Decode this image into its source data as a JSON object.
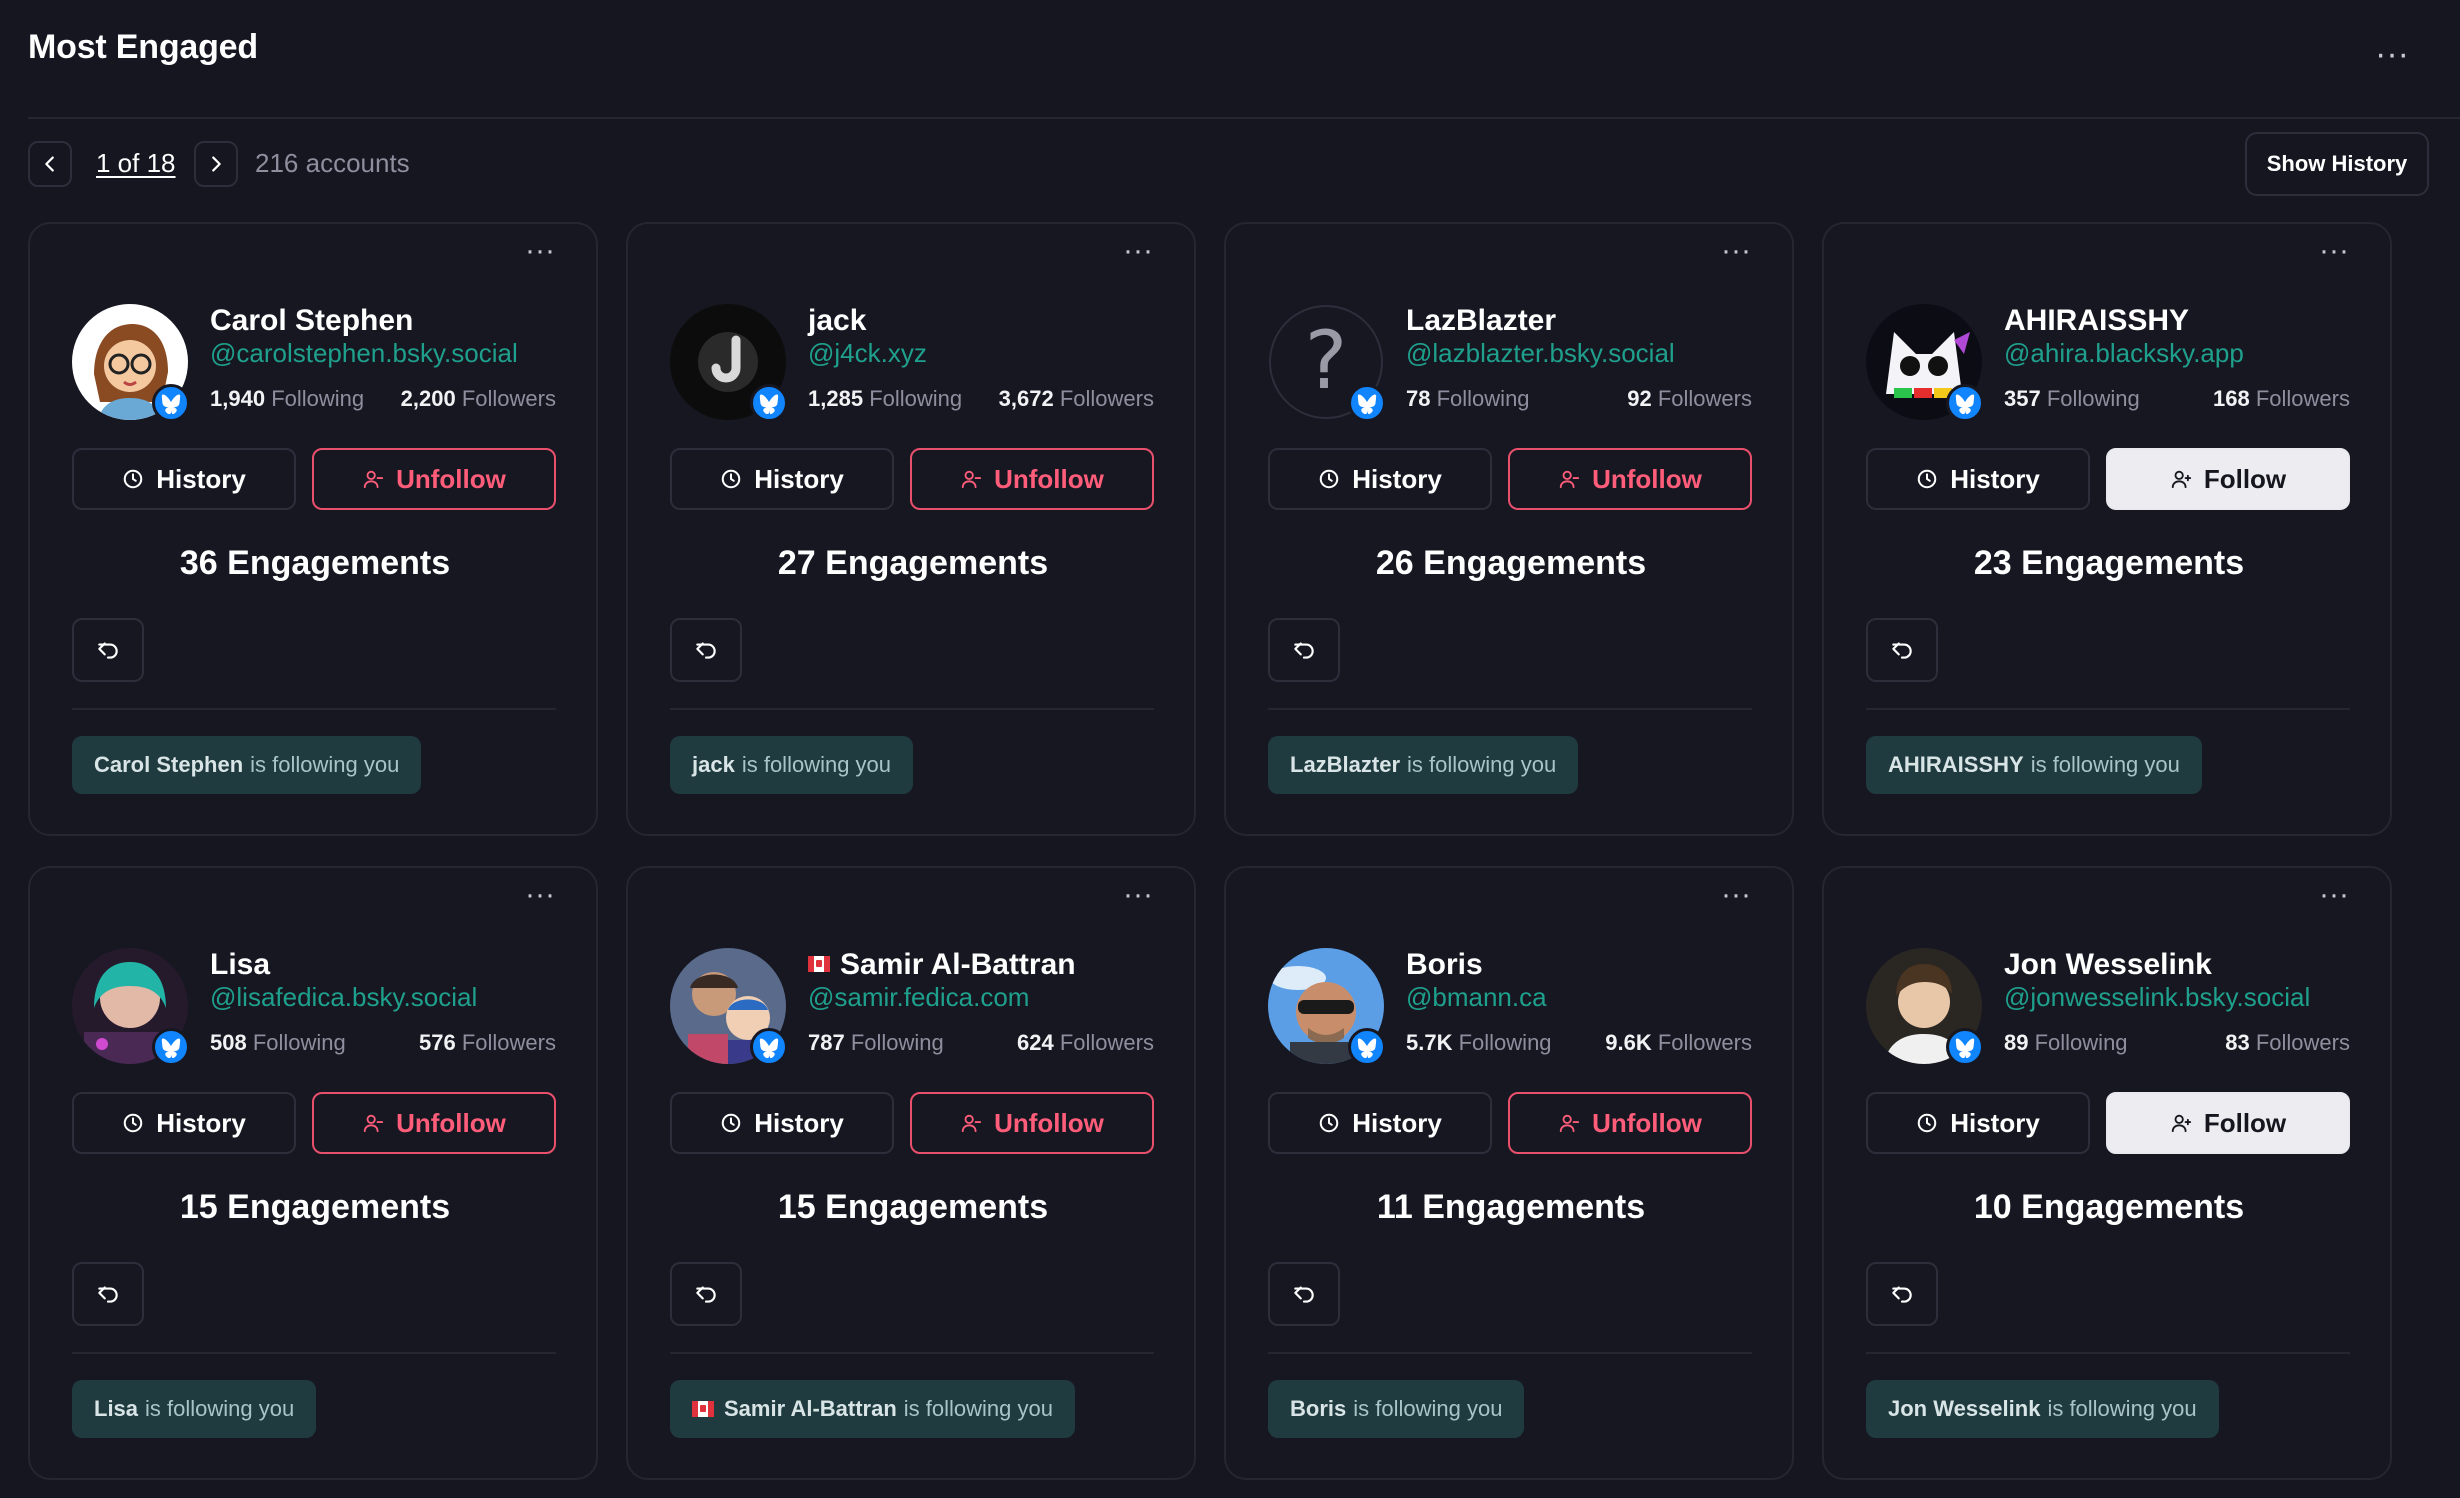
{
  "header": {
    "title": "Most Engaged",
    "menu": "···"
  },
  "pagination": {
    "label": "1 of 18",
    "count": "216 accounts",
    "show_history": "Show History"
  },
  "labels": {
    "following": "Following",
    "followers": "Followers",
    "history": "History",
    "card_menu": "···",
    "follows_you_suffix": "is following you"
  },
  "colors": {
    "background": "#161621",
    "handle": "#1fa08c",
    "unfollow": "#ff5d7a",
    "badge": "#1185fe"
  },
  "cards": [
    {
      "name": "Carol Stephen",
      "handle": "@carolstephen.bsky.social",
      "following": "1,940",
      "followers": "2,200",
      "action": "Unfollow",
      "engagements": "36 Engagements",
      "follows_you_name": "Carol Stephen",
      "avatar": "cartoon-avatar",
      "flag": false
    },
    {
      "name": "jack",
      "handle": "@j4ck.xyz",
      "following": "1,285",
      "followers": "3,672",
      "action": "Unfollow",
      "engagements": "27 Engagements",
      "follows_you_name": "jack",
      "avatar": "letter-j-avatar",
      "flag": false
    },
    {
      "name": "LazBlazter",
      "handle": "@lazblazter.bsky.social",
      "following": "78",
      "followers": "92",
      "action": "Unfollow",
      "engagements": "26 Engagements",
      "follows_you_name": "LazBlazter",
      "avatar": "question-mark-avatar",
      "flag": false
    },
    {
      "name": "AHIRAISSHY",
      "handle": "@ahira.blacksky.app",
      "following": "357",
      "followers": "168",
      "action": "Follow",
      "engagements": "23 Engagements",
      "follows_you_name": "AHIRAISSHY",
      "avatar": "cat-avatar",
      "flag": false
    },
    {
      "name": "Lisa",
      "handle": "@lisafedica.bsky.social",
      "following": "508",
      "followers": "576",
      "action": "Unfollow",
      "engagements": "15 Engagements",
      "follows_you_name": "Lisa",
      "avatar": "photo-avatar",
      "flag": false
    },
    {
      "name": "Samir Al-Battran",
      "handle": "@samir.fedica.com",
      "following": "787",
      "followers": "624",
      "action": "Unfollow",
      "engagements": "15 Engagements",
      "follows_you_name": "Samir Al-Battran",
      "avatar": "photo-avatar",
      "flag": true
    },
    {
      "name": "Boris",
      "handle": "@bmann.ca",
      "following": "5.7K",
      "followers": "9.6K",
      "action": "Unfollow",
      "engagements": "11 Engagements",
      "follows_you_name": "Boris",
      "avatar": "photo-avatar",
      "flag": false
    },
    {
      "name": "Jon Wesselink",
      "handle": "@jonwesselink.bsky.social",
      "following": "89",
      "followers": "83",
      "action": "Follow",
      "engagements": "10 Engagements",
      "follows_you_name": "Jon Wesselink",
      "avatar": "photo-avatar",
      "flag": false
    }
  ]
}
